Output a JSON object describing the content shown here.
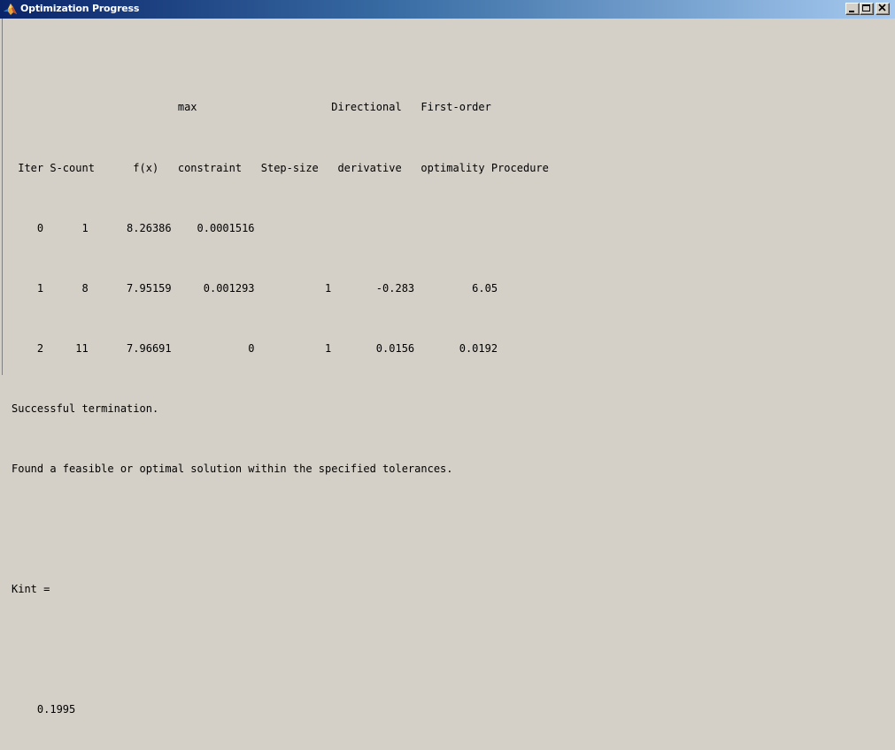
{
  "window": {
    "title": "Optimization Progress",
    "icon": "matlab-logo-icon",
    "buttons": {
      "minimize": "minimize-icon",
      "maximize": "maximize-icon",
      "close": "close-icon"
    }
  },
  "colors": {
    "background": "#d4d0c8",
    "titlebar_start": "#0a246a",
    "titlebar_end": "#a6caf0",
    "text": "#000000"
  },
  "output": {
    "table": {
      "header_line_1": "                          max                     Directional   First-order",
      "header_line_2": " Iter S-count      f(x)   constraint   Step-size   derivative   optimality Procedure",
      "columns": [
        "Iter",
        "S-count",
        "f(x)",
        "max constraint",
        "Step-size",
        "Directional derivative",
        "First-order optimality",
        "Procedure"
      ],
      "rows": [
        {
          "text": "    0      1      8.26386    0.0001516",
          "values": [
            "0",
            "1",
            "8.26386",
            "0.0001516",
            "",
            "",
            "",
            ""
          ]
        },
        {
          "text": "    1      8      7.95159     0.001293           1       -0.283         6.05",
          "values": [
            "1",
            "8",
            "7.95159",
            "0.001293",
            "1",
            "-0.283",
            "6.05",
            ""
          ]
        },
        {
          "text": "    2     11      7.96691            0           1       0.0156       0.0192",
          "values": [
            "2",
            "11",
            "7.96691",
            "0",
            "1",
            "0.0156",
            "0.0192",
            ""
          ]
        }
      ]
    },
    "termination_message": "Successful termination.",
    "solution_message": "Found a feasible or optimal solution within the specified tolerances.",
    "blank": "",
    "result_label": "Kint =",
    "result_value": "    0.1995"
  }
}
